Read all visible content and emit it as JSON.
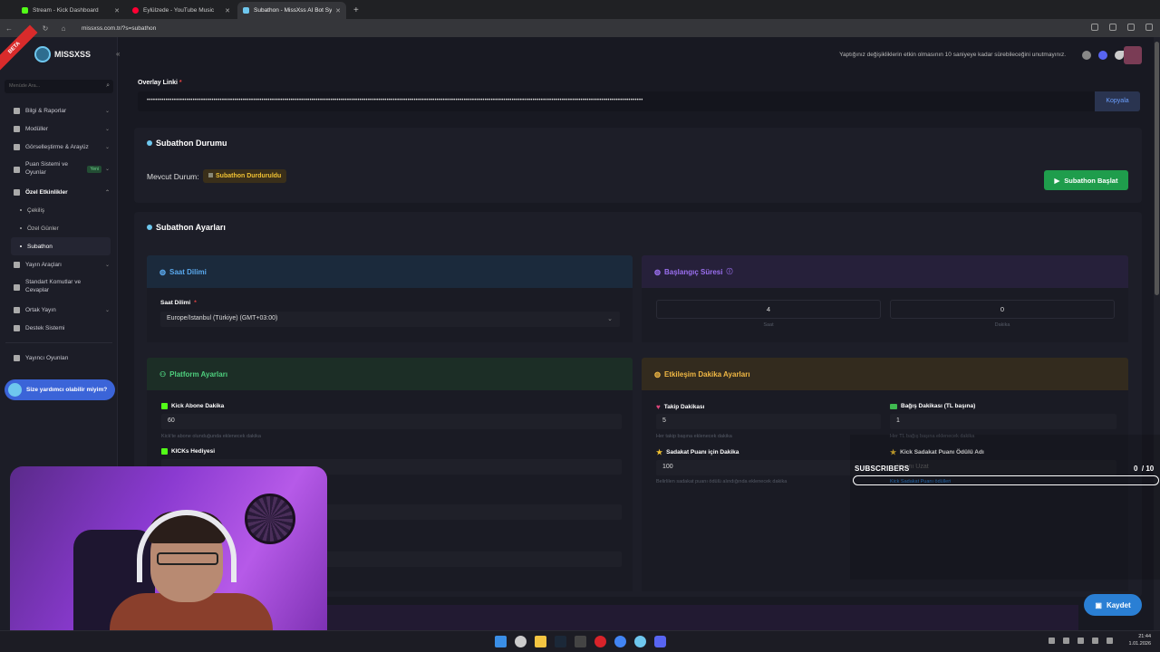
{
  "browser": {
    "tabs": [
      {
        "title": "Stream - Kick Dashboard",
        "color": "#53fc18"
      },
      {
        "title": "Eylülzede - YouTube Music",
        "color": "#ff0033"
      },
      {
        "title": "Subathon - MissXss AI Bot Syst...",
        "color": "#6ec7ee"
      }
    ],
    "url": "missxss.com.tr/?s=subathon"
  },
  "sidebar": {
    "beta": "BETA",
    "logo": "MISSXSS",
    "search_placeholder": "Menüde Ara...",
    "items": [
      {
        "label": "Bilgi & Raporlar"
      },
      {
        "label": "Modüller"
      },
      {
        "label": "Görselleştirme & Arayüz"
      },
      {
        "label": "Puan Sistemi ve Oyunlar",
        "badge": "Yeni"
      },
      {
        "label": "Özel Etkinlikler"
      },
      {
        "label": "Yayın Araçları"
      },
      {
        "label": "Standart Komutlar ve Cevaplar"
      },
      {
        "label": "Ortak Yayın"
      },
      {
        "label": "Destek Sistemi"
      },
      {
        "label": "Yayıncı Oyunları"
      }
    ],
    "subitems": [
      "Çekiliş",
      "Özel Günler",
      "Subathon"
    ],
    "help": "Size yardımcı olabilir miyim?"
  },
  "topbar": {
    "notice": "Yaptığınız değişikliklerin etkin olmasının 10 saniyeye kadar sürebileceğini unutmayınız."
  },
  "overlay": {
    "label": "Overlay Linki",
    "value": "••••••••••••••••••••••••••••••••••••••••••••••••••••••••••••••••••••••••••••••••••••••••••••••••••••••••••••••••••••••••••••••••••••••••••••••••••••••••••••••••••••••••••••••••••••••••••••••••••••••••••••••••••••••••••••••••••••••••••••••",
    "copy": "Kopyala"
  },
  "status": {
    "title": "Subathon Durumu",
    "current_label": "Mevcut Durum:",
    "badge": "Subathon Durduruldu",
    "start_button": "Subathon Başlat"
  },
  "settings": {
    "title": "Subathon Ayarları",
    "timezone": {
      "header": "Saat Dilimi",
      "label": "Saat Dilimi",
      "value": "Europe/Istanbul (Türkiye) (GMT+03:00)"
    },
    "start_duration": {
      "header": "Başlangıç Süresi",
      "hours": "4",
      "hours_label": "Saat",
      "minutes": "0",
      "minutes_label": "Dakika"
    },
    "platform": {
      "header": "Platform Ayarları",
      "kick_sub_label": "Kick Abone Dakika",
      "kick_sub_value": "60",
      "kick_sub_hint": "Kick'te abone olunduğunda eklenecek dakika",
      "kicks_gift_label": "KICKs Hediyesi"
    },
    "interaction": {
      "header": "Etkileşim Dakika Ayarları",
      "follow_label": "Takip Dakikası",
      "follow_value": "5",
      "follow_hint": "Her takip başına eklenecek dakika",
      "donation_label": "Bağış Dakikası (TL başına)",
      "donation_value": "1",
      "donation_hint": "Her TL bağış başına eklenecek dakika",
      "loyalty_label": "Sadakat Puanı için Dakika",
      "loyalty_value": "100",
      "loyalty_hint": "Belirlilen sadakat puanı ödülü alındığında eklenecek dakika",
      "reward_label": "Kick Sadakat Puanı Ödülü Adı",
      "reward_value": "Yayını Uzat",
      "reward_hint": "Kick Sadakat Puanı ödülleri"
    },
    "save": "Kaydet"
  },
  "subscribers_overlay": {
    "label": "SUBSCRIBERS",
    "count": "0",
    "goal": "/ 10",
    "progress": 0
  },
  "taskbar": {
    "time": "21:44",
    "date": "1.01.2026"
  },
  "colors": {
    "accent_blue": "#2a7fd4",
    "start_green": "#1f9d4c",
    "status_yellow": "#f1c232",
    "kick_green": "#53fc18"
  }
}
